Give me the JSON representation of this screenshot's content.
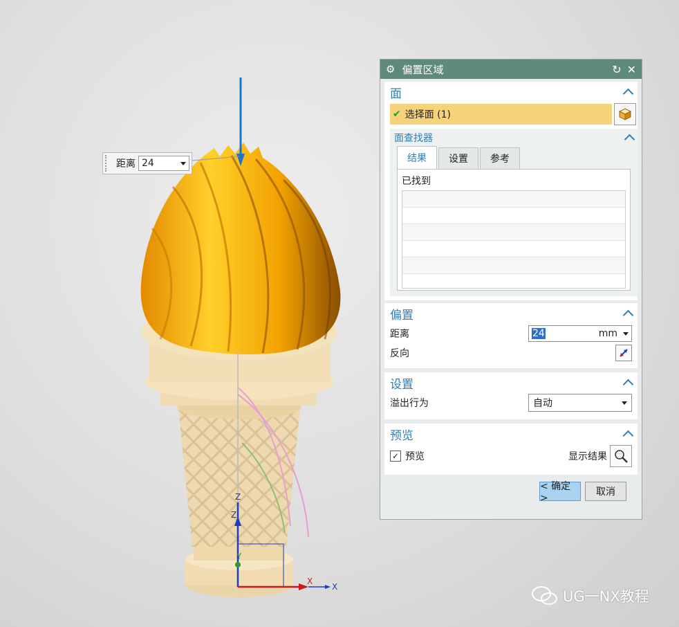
{
  "callout": {
    "label": "距离",
    "value": "24"
  },
  "dialog": {
    "title": "偏置区域",
    "face_section": {
      "title": "面",
      "select_label": "选择面 (1)",
      "finder": {
        "title": "面查找器",
        "tabs": [
          "结果",
          "设置",
          "参考"
        ],
        "found_label": "已找到"
      }
    },
    "offset_section": {
      "title": "偏置",
      "distance_label": "距离",
      "distance_value": "24",
      "distance_unit": "mm",
      "reverse_label": "反向"
    },
    "settings_section": {
      "title": "设置",
      "overflow_label": "溢出行为",
      "overflow_value": "自动"
    },
    "preview_section": {
      "title": "预览",
      "preview_label": "预览",
      "preview_checked": true,
      "show_result_label": "显示结果"
    },
    "ok_label": "< 确定 >",
    "cancel_label": "取消"
  },
  "axis_labels": {
    "z": "Z",
    "x": "X",
    "y": "Y"
  },
  "watermark": "UG一NX教程",
  "colors": {
    "titlebar": "#5e8a7d",
    "accent": "#2f7fb3",
    "selection": "#f6d27a",
    "cream": "#ffa800",
    "cone": "#f1dcb1"
  }
}
